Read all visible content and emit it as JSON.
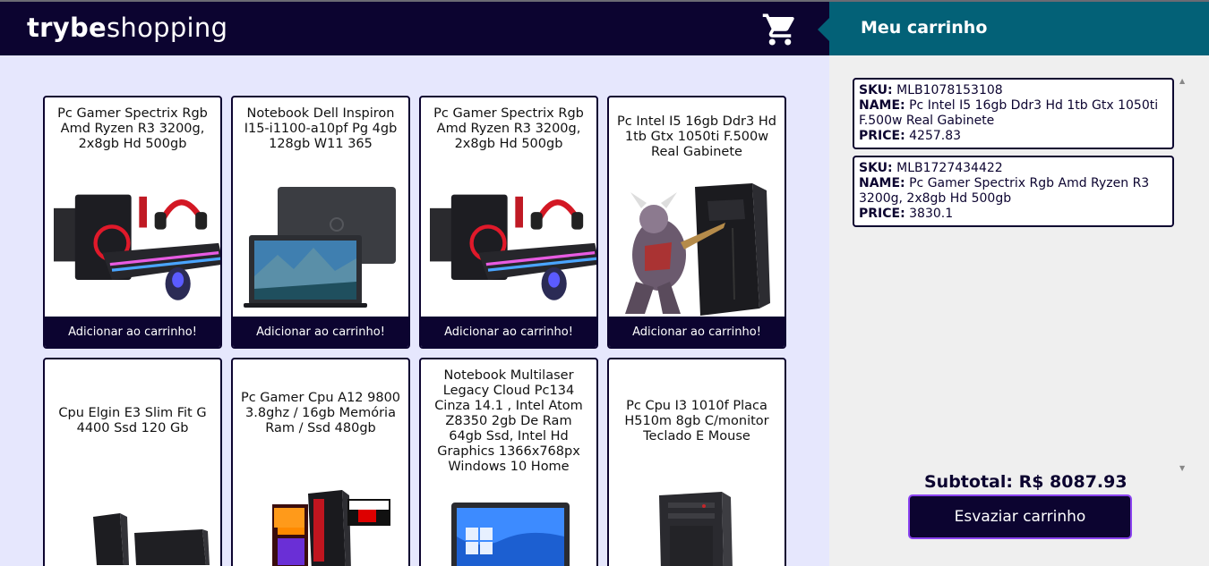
{
  "header": {
    "logo_bold": "trybe",
    "logo_light": "shopping",
    "cart_icon": "shopping-cart-icon"
  },
  "products": [
    {
      "title": "Pc Gamer Spectrix Rgb Amd Ryzen R3 3200g, 2x8gb Hd 500gb",
      "button": "Adicionar ao carrinho!",
      "image": "gaming-pc-image"
    },
    {
      "title": "Notebook Dell Inspiron I15-i1100-a10pf Pg 4gb 128gb W11 365",
      "button": "Adicionar ao carrinho!",
      "image": "laptop-image"
    },
    {
      "title": "Pc Gamer Spectrix Rgb Amd Ryzen R3 3200g, 2x8gb Hd 500gb",
      "button": "Adicionar ao carrinho!",
      "image": "gaming-pc-image"
    },
    {
      "title": "Pc Intel I5 16gb Ddr3 Hd 1tb Gtx 1050ti F.500w Real Gabinete",
      "button": "Adicionar ao carrinho!",
      "image": "tower-with-character-image"
    },
    {
      "title": "Cpu Elgin E3 Slim Fit G 4400 Ssd 120 Gb",
      "button": "",
      "image": "slim-cpu-image"
    },
    {
      "title": "Pc Gamer Cpu A12 9800 3.8ghz / 16gb Memória Ram / Ssd 480gb",
      "button": "",
      "image": "amd-gaming-pc-image"
    },
    {
      "title": "Notebook Multilaser Legacy Cloud Pc134 Cinza 14.1 , Intel Atom Z8350 2gb De Ram 64gb Ssd, Intel Hd Graphics 1366x768px Windows 10 Home",
      "button": "",
      "image": "windows-laptop-image"
    },
    {
      "title": "Pc Cpu I3 1010f Placa H510m 8gb C/monitor Teclado E Mouse",
      "button": "",
      "image": "office-tower-image"
    }
  ],
  "cart": {
    "title": "Meu carrinho",
    "items": [
      {
        "sku_label": "SKU:",
        "sku": "MLB1078153108",
        "name_label": "NAME:",
        "name": "Pc Intel I5 16gb Ddr3 Hd 1tb Gtx 1050ti F.500w Real Gabinete",
        "price_label": "PRICE:",
        "price": "4257.83"
      },
      {
        "sku_label": "SKU:",
        "sku": "MLB1727434422",
        "name_label": "NAME:",
        "name": "Pc Gamer Spectrix Rgb Amd Ryzen R3 3200g, 2x8gb Hd 500gb",
        "price_label": "PRICE:",
        "price": "3830.1"
      }
    ],
    "subtotal": "Subtotal:  R$ 8087.93",
    "empty_button": "Esvaziar carrinho"
  },
  "colors": {
    "header_bg": "#0c0430",
    "cart_header_bg": "#036177",
    "page_bg": "#e6e7fd",
    "accent_border": "#8b43f0"
  }
}
